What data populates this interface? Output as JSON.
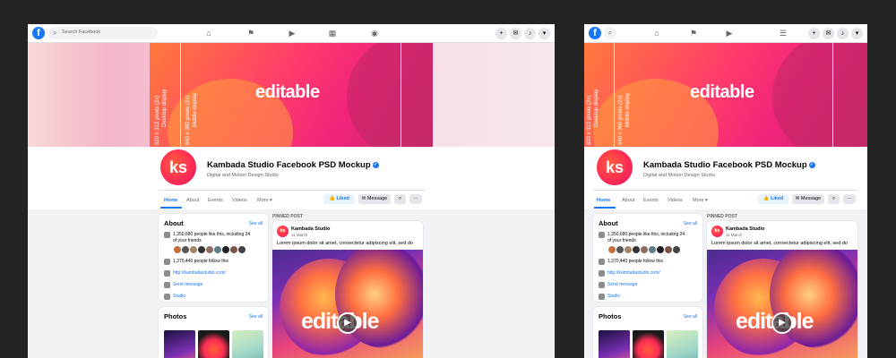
{
  "topbar": {
    "logo": "f",
    "search_placeholder": "Search Facebook",
    "search_icon": "search-icon",
    "nav_icons": [
      "home-icon",
      "flag-icon",
      "video-icon",
      "marketplace-icon",
      "groups-icon"
    ],
    "mobile_nav_icons": [
      "home-icon",
      "flag-icon",
      "video-icon",
      "menu-icon"
    ],
    "right_icons": [
      "plus-icon",
      "messenger-icon",
      "bell-icon",
      "caret-down-icon"
    ]
  },
  "cover": {
    "title": "editable",
    "size_labels": [
      "820 x 312 pixels (2x)",
      "Desktop display"
    ],
    "mobile_size_labels": [
      "640 x 360 pixels (2x)",
      "Mobile display"
    ]
  },
  "profile": {
    "avatar_text": "ks",
    "name": "Kambada Studio Facebook PSD Mockup",
    "subtitle": "Digital and Motion Design Studio"
  },
  "tabs": [
    "Home",
    "About",
    "Events",
    "Videos",
    "More ▾"
  ],
  "actions": {
    "liked": "Liked",
    "message": "Message",
    "search_icon": "search-icon",
    "more": "···"
  },
  "about": {
    "title": "About",
    "see_all": "See all",
    "likes_line1": "1,350,680 people like this, including 24",
    "likes_line2": "of your friends",
    "follows": "1,370,440 people follow this",
    "website": "http://kambadastudio.com/",
    "send_message": "Send message",
    "category": "Studio"
  },
  "photos": {
    "title": "Photos",
    "see_all": "See all"
  },
  "pinned_post": {
    "label": "PINNED POST",
    "author": "Kambada Studio",
    "date": "11 March",
    "text": "Lorem ipsum dolor sit amet, consectetur adipiscing elit, sed do",
    "image_text": "editable"
  },
  "colors": {
    "brand": "#1877f2",
    "cover_pink": "#f0237a",
    "cover_orange": "#ff7a3c"
  }
}
